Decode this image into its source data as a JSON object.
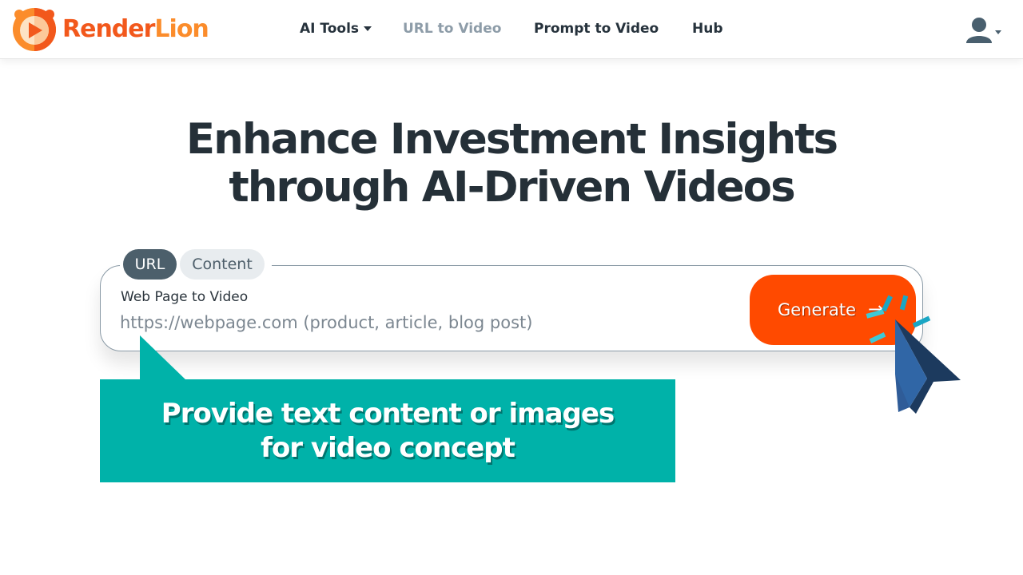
{
  "brand": {
    "name_part1": "Render",
    "name_part2": "Lion",
    "colors": {
      "primary": "#f2581c",
      "secondary": "#fb8c2b"
    }
  },
  "nav": {
    "items": [
      {
        "label": "AI Tools",
        "has_dropdown": true,
        "active": false
      },
      {
        "label": "URL to Video",
        "active": true
      },
      {
        "label": "Prompt to Video",
        "active": false
      },
      {
        "label": "Hub",
        "active": false
      }
    ],
    "user_icon": "user-icon"
  },
  "hero": {
    "line1": "Enhance Investment Insights",
    "line2": "through AI-Driven Videos"
  },
  "form": {
    "tabs": [
      {
        "label": "URL",
        "selected": true
      },
      {
        "label": "Content",
        "selected": false
      }
    ],
    "field_label": "Web Page to Video",
    "input_value": "",
    "input_placeholder": "https://webpage.com (product, article, blog post)",
    "generate_label": "Generate",
    "generate_icon": "arrow-right-icon",
    "accent_color": "#ff4a00"
  },
  "callout": {
    "line1": "Provide text content or images",
    "line2": "for video concept",
    "color": "#00b2a9"
  }
}
